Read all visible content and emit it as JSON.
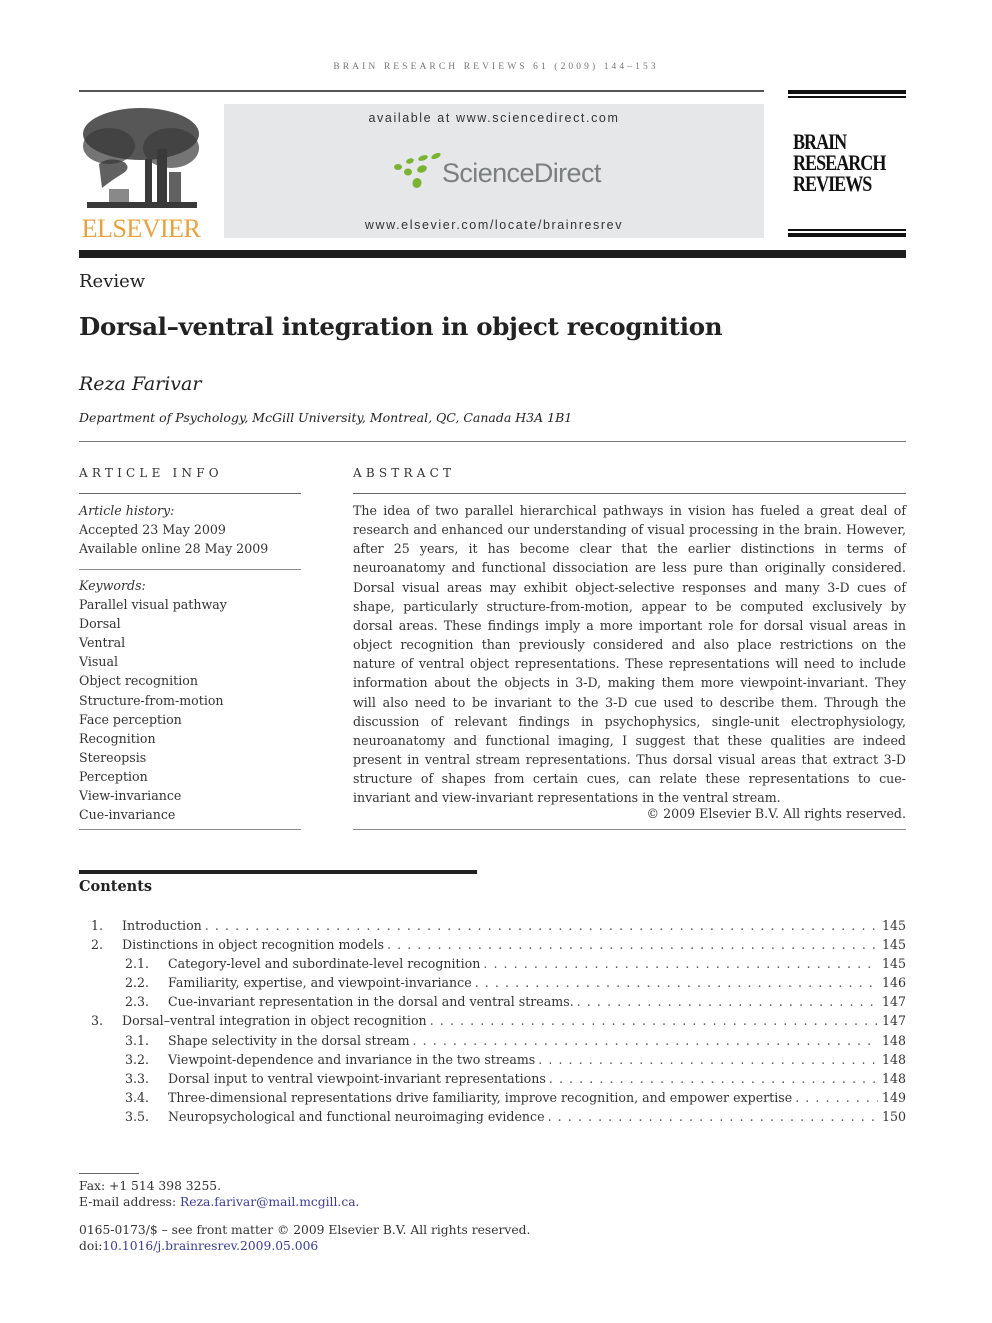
{
  "running_head": "BRAIN RESEARCH REVIEWS 61 (2009) 144–153",
  "masthead": {
    "publisher_name": "ELSEVIER",
    "publisher_color": "#e9a23b",
    "available_text": "available at www.sciencedirect.com",
    "sciencedirect_name": "ScienceDirect",
    "sciencedirect_dot_color": "#7ab332",
    "journal_url": "www.elsevier.com/locate/brainresrev",
    "journal_title_lines": [
      "BRAIN",
      "RESEARCH",
      "REVIEWS"
    ]
  },
  "article": {
    "type": "Review",
    "title": "Dorsal–ventral integration in object recognition",
    "author": "Reza Farivar",
    "affiliation": "Department of Psychology, McGill University, Montreal, QC, Canada H3A 1B1"
  },
  "article_info": {
    "heading": "ARTICLE INFO",
    "history_label": "Article history:",
    "history": [
      "Accepted 23 May 2009",
      "Available online 28 May 2009"
    ],
    "keywords_label": "Keywords:",
    "keywords": [
      "Parallel visual pathway",
      "Dorsal",
      "Ventral",
      "Visual",
      "Object recognition",
      "Structure-from-motion",
      "Face perception",
      "Recognition",
      "Stereopsis",
      "Perception",
      "View-invariance",
      "Cue-invariance"
    ]
  },
  "abstract": {
    "heading": "ABSTRACT",
    "text": "The idea of two parallel hierarchical pathways in vision has fueled a great deal of research and enhanced our understanding of visual processing in the brain. However, after 25 years, it has become clear that the earlier distinctions in terms of neuroanatomy and functional dissociation are less pure than originally considered. Dorsal visual areas may exhibit object-selective responses and many 3-D cues of shape, particularly structure-from-motion, appear to be computed exclusively by dorsal areas. These findings imply a more important role for dorsal visual areas in object recognition than previously considered and also place restrictions on the nature of ventral object representations. These representations will need to include information about the objects in 3-D, making them more viewpoint-invariant. They will also need to be invariant to the 3-D cue used to describe them. Through the discussion of relevant findings in psychophysics, single-unit electrophysiology, neuroanatomy and functional imaging, I suggest that these qualities are indeed present in ventral stream representations. Thus dorsal visual areas that extract 3-D structure of shapes from certain cues, can relate these representations to cue-invariant and view-invariant representations in the ventral stream.",
    "copyright": "© 2009 Elsevier B.V. All rights reserved."
  },
  "contents": {
    "heading": "Contents",
    "entries": [
      {
        "num": "1.",
        "title": "Introduction",
        "page": "145",
        "level": 1
      },
      {
        "num": "2.",
        "title": "Distinctions in object recognition models",
        "page": "145",
        "level": 1
      },
      {
        "num": "2.1.",
        "title": "Category-level and subordinate-level recognition",
        "page": "145",
        "level": 2
      },
      {
        "num": "2.2.",
        "title": "Familiarity, expertise, and viewpoint-invariance",
        "page": "146",
        "level": 2
      },
      {
        "num": "2.3.",
        "title": "Cue-invariant representation in the dorsal and ventral streams.",
        "page": "147",
        "level": 2
      },
      {
        "num": "3.",
        "title": "Dorsal–ventral integration in object recognition",
        "page": "147",
        "level": 1
      },
      {
        "num": "3.1.",
        "title": "Shape selectivity in the dorsal stream",
        "page": "148",
        "level": 2
      },
      {
        "num": "3.2.",
        "title": "Viewpoint-dependence and invariance in the two streams",
        "page": "148",
        "level": 2
      },
      {
        "num": "3.3.",
        "title": "Dorsal input to ventral viewpoint-invariant representations",
        "page": "148",
        "level": 2
      },
      {
        "num": "3.4.",
        "title": "Three-dimensional representations drive familiarity, improve recognition, and empower expertise",
        "page": "149",
        "level": 2
      },
      {
        "num": "3.5.",
        "title": "Neuropsychological and functional neuroimaging evidence",
        "page": "150",
        "level": 2
      }
    ]
  },
  "footnotes": {
    "fax": "Fax: +1 514 398 3255.",
    "email_label": "E-mail address: ",
    "email": "Reza.farivar@mail.mcgill.ca",
    "email_suffix": ".",
    "front_matter": "0165-0173/$ – see front matter © 2009 Elsevier B.V. All rights reserved.",
    "doi_label": "doi:",
    "doi": "10.1016/j.brainresrev.2009.05.006",
    "link_color": "#3b3b9a"
  }
}
